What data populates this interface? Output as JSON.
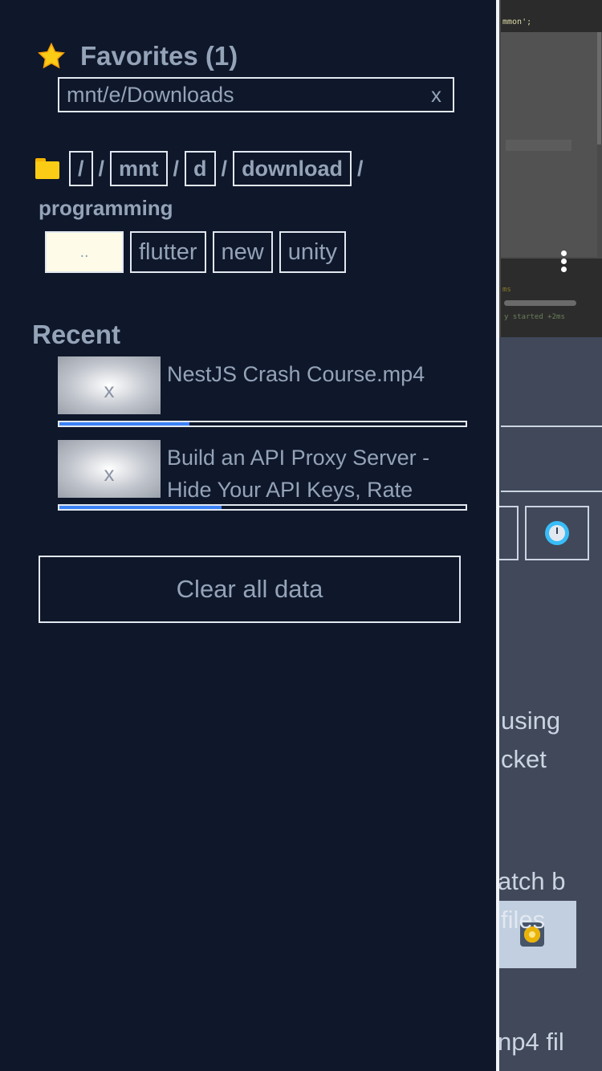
{
  "favorites": {
    "title": "Favorites (1)",
    "items": [
      {
        "path": "mnt/e/Downloads",
        "remove_label": "x"
      }
    ]
  },
  "breadcrumb": {
    "root": "/",
    "parts": [
      "mnt",
      "d",
      "download"
    ],
    "separator": "/",
    "current": "programming"
  },
  "folders": {
    "up_label": "..",
    "items": [
      "flutter",
      "new",
      "unity"
    ]
  },
  "recent": {
    "title": "Recent",
    "items": [
      {
        "name": "NestJS Crash Course.mp4",
        "thumb_label": "x",
        "progress": 0.32
      },
      {
        "name": "Build an API Proxy Server - Hide Your API Keys, Rate Limitin",
        "thumb_label": "x",
        "progress": 0.4
      }
    ]
  },
  "actions": {
    "clear_label": "Clear all data"
  },
  "background": {
    "code_snippet": "mmon';",
    "text_lines": [
      " using",
      "cket",
      "atch b",
      "files",
      "np4 fil"
    ]
  },
  "colors": {
    "drawer_bg": "#0f172a",
    "text": "#94a3b8",
    "accent": "#3b82f6",
    "star": "#facc15",
    "folder": "#facc15"
  }
}
